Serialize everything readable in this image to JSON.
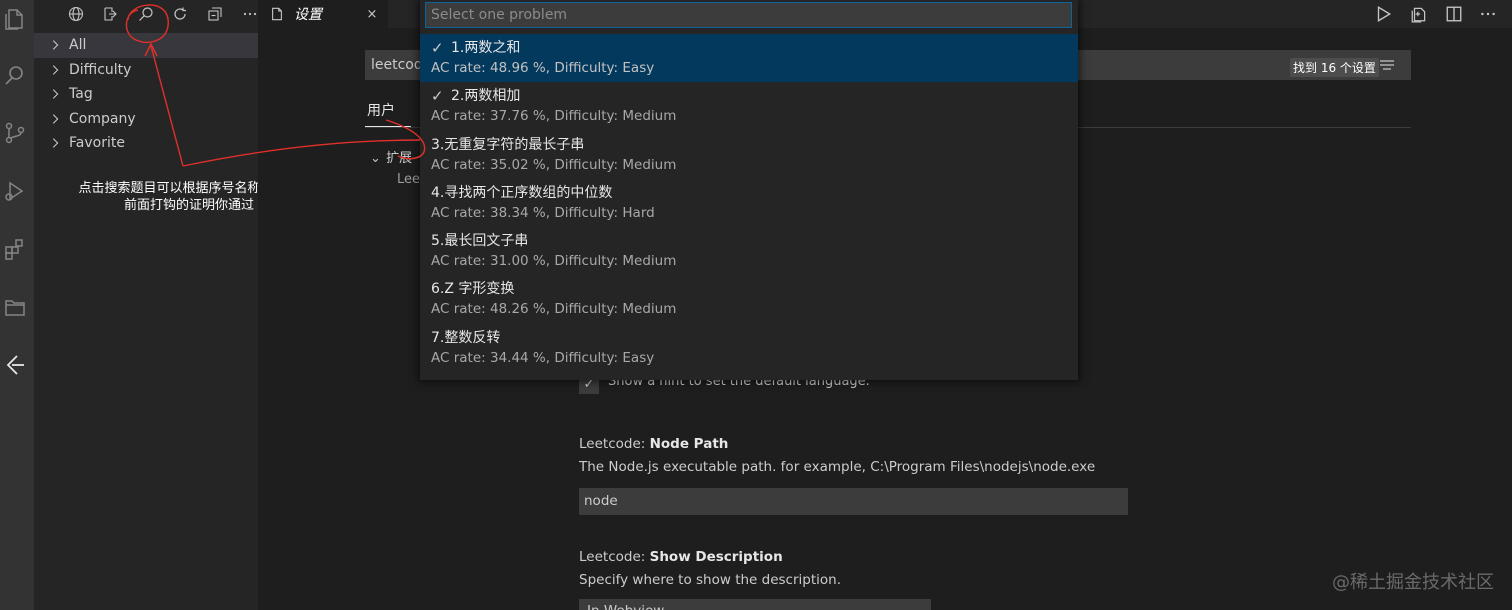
{
  "sidebar": {
    "tree": [
      {
        "label": "All"
      },
      {
        "label": "Difficulty"
      },
      {
        "label": "Tag"
      },
      {
        "label": "Company"
      },
      {
        "label": "Favorite"
      }
    ],
    "annotation_line1": "点击搜索题目可以根据序号名称来搜索",
    "annotation_line2": "前面打钩的证明你通过"
  },
  "editor": {
    "tab_label": "设置",
    "close_symbol": "×",
    "search_value": "leetcode",
    "search_count": "找到 16 个设置",
    "settings_tab_user": "用户",
    "toc_extensions": "扩展",
    "toc_leetcode": "Lee",
    "hint_text": "Show a hint to set the default language.",
    "node_path": {
      "category": "Leetcode: ",
      "key": "Node Path",
      "description": "The Node.js executable path. for example, C:\\Program Files\\nodejs\\node.exe",
      "value": "node"
    },
    "show_description": {
      "category": "Leetcode: ",
      "key": "Show Description",
      "description": "Specify where to show the description.",
      "value": "In Webview"
    }
  },
  "quick_pick": {
    "placeholder": "Select one problem",
    "items": [
      {
        "check": "✓",
        "label": "1.两数之和",
        "desc": "AC rate: 48.96 %, Difficulty: Easy"
      },
      {
        "check": "✓",
        "label": "2.两数相加",
        "desc": "AC rate: 37.76 %, Difficulty: Medium"
      },
      {
        "check": "",
        "label": "3.无重复字符的最长子串",
        "desc": "AC rate: 35.02 %, Difficulty: Medium"
      },
      {
        "check": "",
        "label": "4.寻找两个正序数组的中位数",
        "desc": "AC rate: 38.34 %, Difficulty: Hard"
      },
      {
        "check": "",
        "label": "5.最长回文子串",
        "desc": "AC rate: 31.00 %, Difficulty: Medium"
      },
      {
        "check": "",
        "label": "6.Z 字形变换",
        "desc": "AC rate: 48.26 %, Difficulty: Medium"
      },
      {
        "check": "",
        "label": "7.整数反转",
        "desc": "AC rate: 34.44 %, Difficulty: Easy"
      }
    ]
  },
  "watermark": "@稀土掘金技术社区",
  "icons": {
    "activity": [
      "explorer-icon",
      "search-icon",
      "source-control-icon",
      "run-debug-icon",
      "extensions-icon",
      "folder-icon",
      "leetcode-icon"
    ],
    "sidebar_toolbar": [
      "globe-icon",
      "sign-in-icon",
      "search-icon",
      "refresh-icon",
      "collapse-all-icon",
      "more-icon"
    ],
    "editor_actions": [
      "run-icon",
      "open-changes-icon",
      "split-editor-icon",
      "more-icon"
    ]
  },
  "colors": {
    "accent": "#0e639c",
    "selection": "#04395e",
    "annotation_red": "#e0302a"
  }
}
